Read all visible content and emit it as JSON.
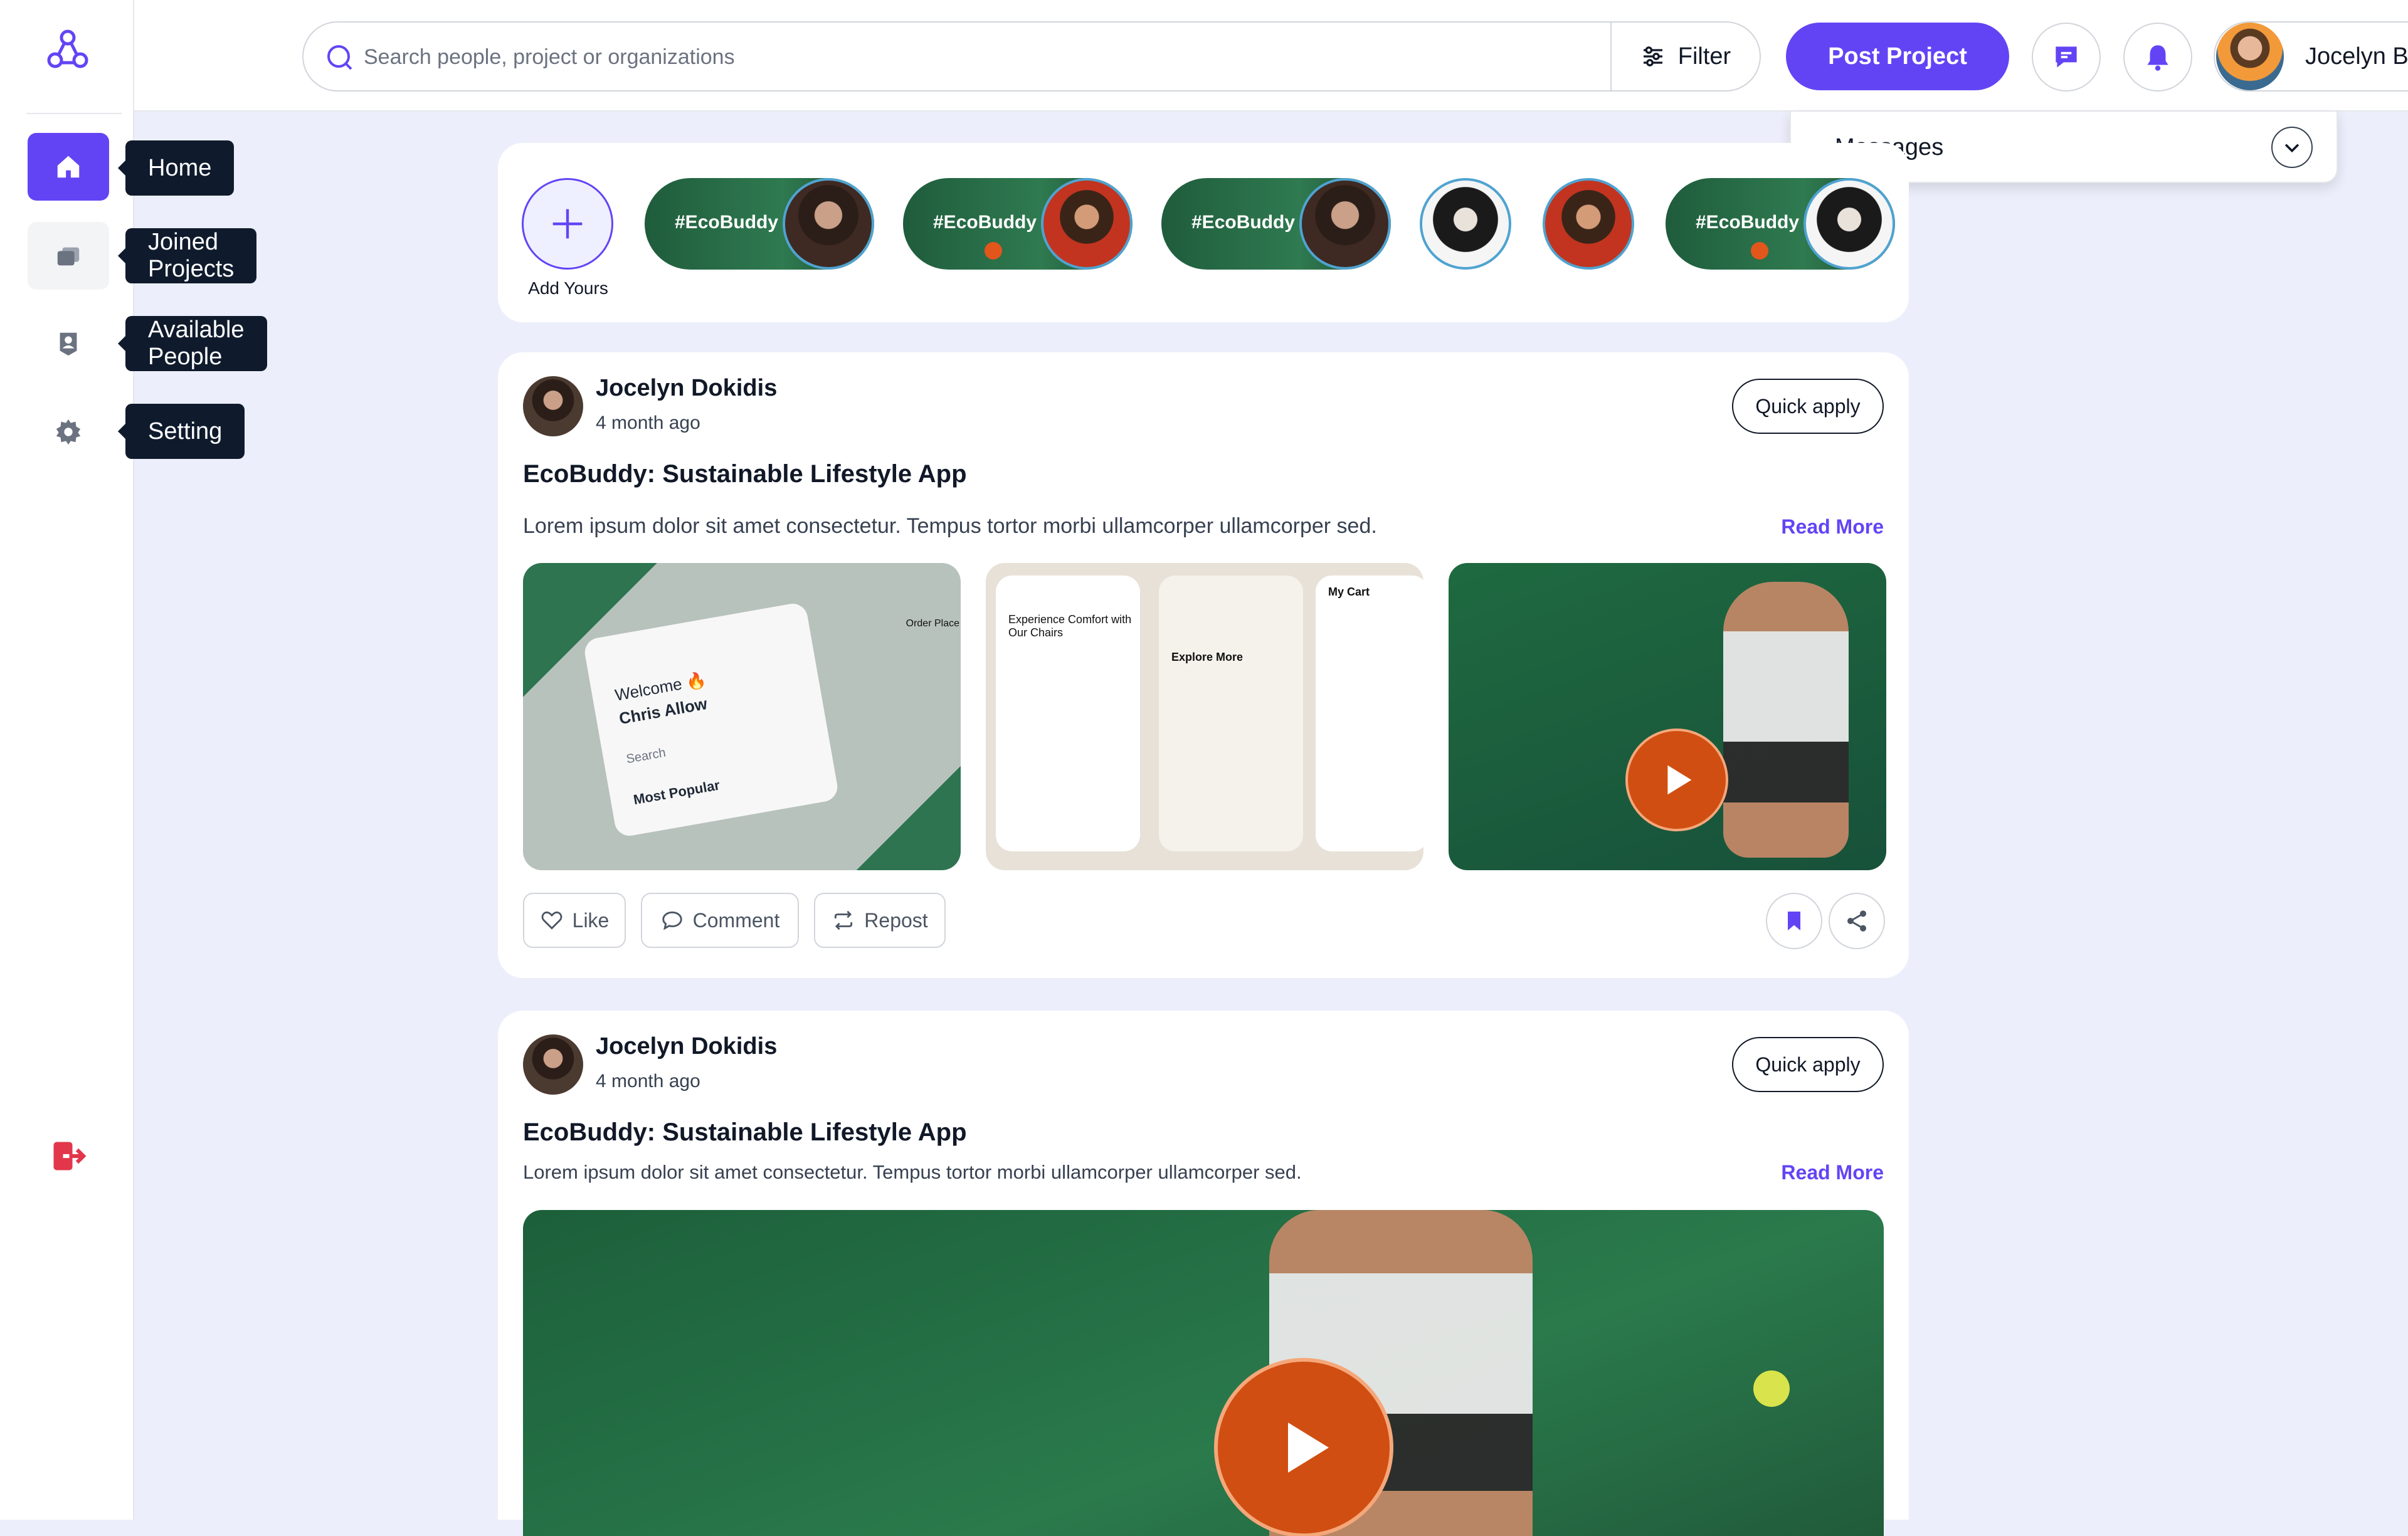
{
  "brand": {
    "accent": "#6344f5",
    "danger": "#e2364b",
    "dark_tooltip": "#0f1b2d"
  },
  "sidebar": {
    "items": [
      {
        "label": "Home",
        "icon": "home-icon"
      },
      {
        "label": "Joined Projects",
        "icon": "folders-icon"
      },
      {
        "label": "Available People",
        "icon": "person-badge-icon"
      },
      {
        "label": "Setting",
        "icon": "gear-icon"
      }
    ],
    "logout_icon": "logout-icon"
  },
  "topbar": {
    "search_placeholder": "Search people, project or organizations",
    "filter_label": "Filter",
    "post_project_label": "Post Project",
    "user_name": "Jocelyn Bergson"
  },
  "messages": {
    "label": "Messages"
  },
  "stories": {
    "add_label": "Add Yours",
    "tags": [
      "#EcoBuddy",
      "#EcoBuddy",
      "#EcoBuddy",
      "#EcoBuddy"
    ]
  },
  "posts": [
    {
      "author": "Jocelyn Dokidis",
      "time": "4 month ago",
      "quick_apply": "Quick apply",
      "title": "EcoBuddy: Sustainable Lifestyle App",
      "description": "Lorem ipsum dolor sit amet consectetur. Tempus tortor morbi ullamcorper ullamcorper sed.",
      "read_more": "Read More",
      "mockup1_texts": [
        "Welcome 🔥",
        "Chris Allow",
        "Search",
        "Most Popular",
        "Order Place"
      ],
      "mockup2_texts": [
        "Experience Comfort with Our Chairs",
        "Explore More",
        "My Cart"
      ],
      "actions": {
        "like": "Like",
        "comment": "Comment",
        "repost": "Repost"
      }
    },
    {
      "author": "Jocelyn Dokidis",
      "time": "4 month ago",
      "quick_apply": "Quick apply",
      "title": "EcoBuddy: Sustainable Lifestyle App",
      "description": "Lorem ipsum dolor sit amet consectetur. Tempus tortor morbi ullamcorper ullamcorper sed.",
      "read_more": "Read More"
    }
  ]
}
